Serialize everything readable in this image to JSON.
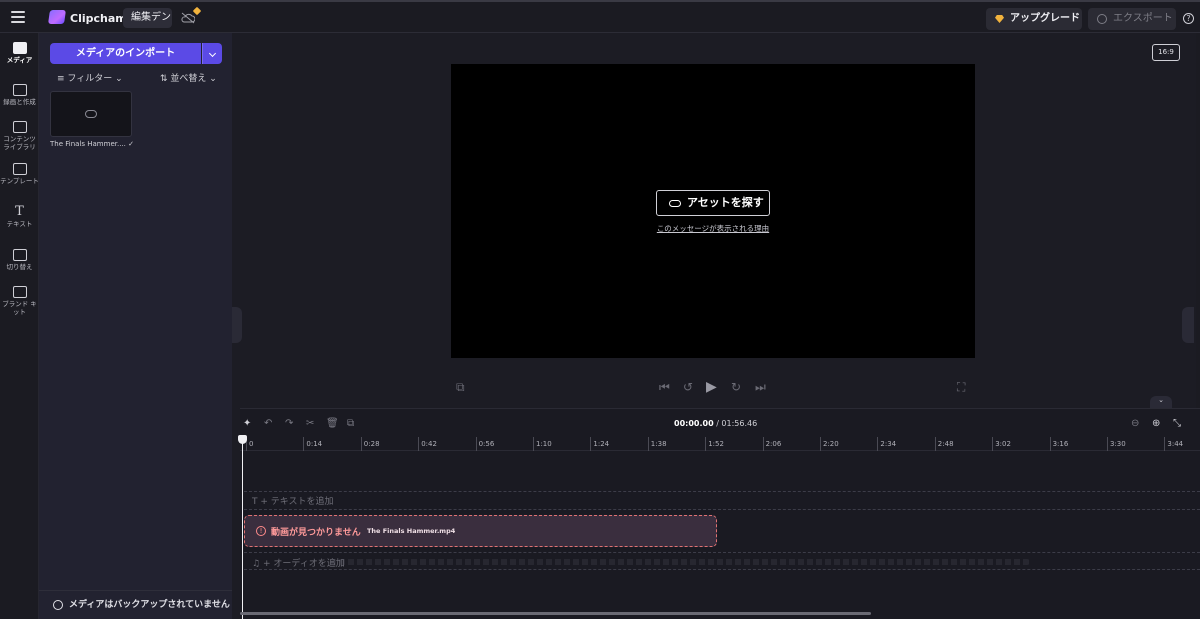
{
  "app": {
    "name": "Clipchamp",
    "project_name": "編集デン"
  },
  "topbar": {
    "upgrade_label": "アップグレード",
    "export_label": "エクスポート",
    "help_label": "?"
  },
  "rail": {
    "items": [
      {
        "label": "メディア",
        "icon": "folder-icon"
      },
      {
        "label": "録画と作成",
        "icon": "camera-icon"
      },
      {
        "label": "コンテンツ\nライブラリ",
        "icon": "library-icon"
      },
      {
        "label": "テンプレート",
        "icon": "template-icon"
      },
      {
        "label": "テキスト",
        "icon": "text-icon"
      },
      {
        "label": "切り替え",
        "icon": "transition-icon"
      },
      {
        "label": "ブランド キット",
        "icon": "brand-kit-icon"
      }
    ]
  },
  "media_panel": {
    "import_label": "メディアのインポート",
    "filter_label": "フィルター",
    "sort_label": "並べ替え",
    "thumbnail_name": "The Finals Hammer....",
    "backup_message": "メディアはバックアップされていません"
  },
  "preview": {
    "aspect_ratio": "16:9",
    "find_asset_label": "アセットを探す",
    "why_link": "このメッセージが表示される理由"
  },
  "timeline": {
    "current_time": "00:00.00",
    "total_time": "/ 01:56.46",
    "ruler_ticks": [
      "0",
      "0:14",
      "0:28",
      "0:42",
      "0:56",
      "1:10",
      "1:24",
      "1:38",
      "1:52",
      "2:06",
      "2:20",
      "2:34",
      "2:48",
      "3:02",
      "3:16",
      "3:30",
      "3:44"
    ],
    "add_text_label": "+ テキストを追加",
    "add_audio_label": "+ オーディオを追加",
    "clip_error": "動画が見つかりません",
    "clip_filename": "The Finals Hammer.mp4"
  },
  "colors": {
    "accent": "#5b4ae6",
    "error": "#e07272",
    "upgrade_gem": "#f2b33d"
  }
}
